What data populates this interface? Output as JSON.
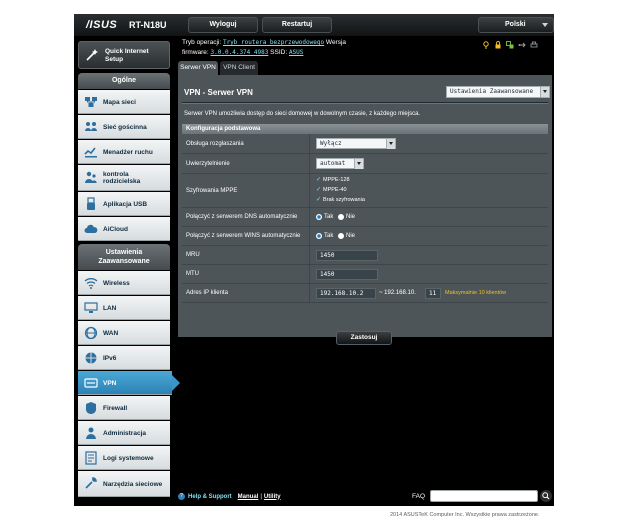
{
  "header": {
    "logo": "/ISUS",
    "model": "RT-N18U",
    "logout_label": "Wyloguj",
    "reboot_label": "Restartuj",
    "language": "Polski"
  },
  "info": {
    "mode_label": "Tryb operacji:",
    "mode_value": "Tryb routera bezprzewodowego",
    "version_label": "Wersja",
    "firmware_label": "firmware:",
    "firmware_value": "3.0.0.4.374_4983",
    "ssid_label": "SSID:",
    "ssid_value": "ASUS"
  },
  "sidebar": {
    "quick_setup": "Quick Internet Setup",
    "general_header": "Ogólne",
    "general_items": [
      {
        "label": "Mapa sieci"
      },
      {
        "label": "Sieć gościnna"
      },
      {
        "label": "Menadżer ruchu"
      },
      {
        "label": "kontrola rodzicielska"
      },
      {
        "label": "Aplikacja USB"
      },
      {
        "label": "AiCloud"
      }
    ],
    "advanced_header_line1": "Ustawienia",
    "advanced_header_line2": "Zaawansowane",
    "advanced_items": [
      {
        "label": "Wireless"
      },
      {
        "label": "LAN"
      },
      {
        "label": "WAN"
      },
      {
        "label": "IPv6"
      },
      {
        "label": "VPN"
      },
      {
        "label": "Firewall"
      },
      {
        "label": "Administracja"
      },
      {
        "label": "Logi systemowe"
      },
      {
        "label": "Narzędzia sieciowe"
      }
    ],
    "active_item": "VPN"
  },
  "tabs": [
    "Serwer VPN",
    "VPN Client"
  ],
  "panel": {
    "title": "VPN - Serwer VPN",
    "mode_select": "Ustawienia Zaawansowane",
    "description": "Serwer VPN umożliwia dostęp do sieci domowej w dowolnym czasie, z każdego miejsca.",
    "config_header": "Konfiguracja podstawowa",
    "rows": {
      "broadcast": {
        "label": "Obsługa rozgłaszania",
        "value": "Wyłącz"
      },
      "auth": {
        "label": "Uwierzytelnienie",
        "value": "automat"
      },
      "mppe": {
        "label": "Szyfrowania MPPE",
        "options": [
          "MPPE-128",
          "MPPE-40",
          "Brak szyfrowania"
        ]
      },
      "dns": {
        "label": "Połączyć z serwerem DNS automatycznie",
        "yes": "Tak",
        "no": "Nie"
      },
      "wins": {
        "label": "Połączyć z serwerem WINS automatycznie",
        "yes": "Tak",
        "no": "Nie"
      },
      "mru": {
        "label": "MRU",
        "value": "1450"
      },
      "mtu": {
        "label": "MTU",
        "value": "1450"
      },
      "client_ip": {
        "label": "Adres IP klienta",
        "start": "192.168.10.2",
        "end_prefix": "~ 192.168.10.",
        "end": "11",
        "note": "Maksymalnie 10 klientów"
      }
    },
    "apply_label": "Zastosuj"
  },
  "footer": {
    "help_support": "Help & Support",
    "manual": "Manual",
    "separator": "|",
    "utility": "Utility",
    "faq": "FAQ",
    "copyright": "2014 ASUSTeK Computer Inc. Wszystkie prawa zastrzeżone."
  },
  "colors": {
    "accent": "#2d82b5",
    "link": "#7ee0f3",
    "warning": "#f0c020",
    "panel": "#4d5558"
  }
}
